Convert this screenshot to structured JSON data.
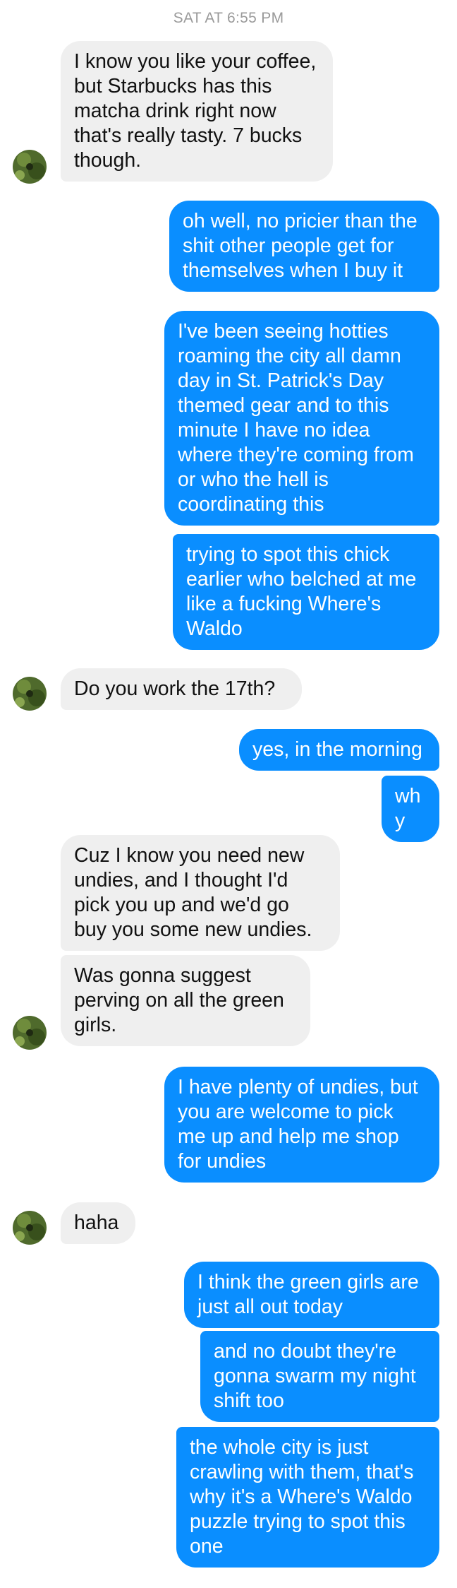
{
  "thread": {
    "timestamp": "SAT AT 6:55 PM",
    "messages": [
      {
        "from": "them",
        "text": "I know you like your coffee, but Starbucks has this matcha drink right now that's really tasty. 7 bucks though."
      },
      {
        "from": "me",
        "text": "oh well, no pricier than the shit other people get for themselves when I buy it"
      },
      {
        "from": "me",
        "text": "I've been seeing hotties roaming the city all damn day in St. Patrick's Day themed gear and to this minute I have no idea where they're coming from or who the hell is coordinating this"
      },
      {
        "from": "me",
        "text": "trying to spot this chick earlier who belched at me like a fucking Where's Waldo"
      },
      {
        "from": "them",
        "text": "Do you work the 17th?"
      },
      {
        "from": "me",
        "text": "yes, in the morning"
      },
      {
        "from": "me",
        "text": "why"
      },
      {
        "from": "them",
        "text": "Cuz I know you need new undies, and I thought I'd pick you up and we'd go buy you some new undies."
      },
      {
        "from": "them",
        "text": "Was gonna suggest perving on all the green girls."
      },
      {
        "from": "me",
        "text": "I have plenty of undies, but you are welcome to pick me up and help me shop for undies"
      },
      {
        "from": "them",
        "text": "haha"
      },
      {
        "from": "me",
        "text": "I think the green girls are just all out today"
      },
      {
        "from": "me",
        "text": "and no doubt they're gonna swarm my night shift too"
      },
      {
        "from": "me",
        "text": "the whole city is just crawling with them, that's why it's a Where's Waldo puzzle trying to spot this one"
      }
    ]
  },
  "colors": {
    "outgoing_bubble": "#0a8eff",
    "incoming_bubble": "#efefef",
    "timestamp_text": "#9a9a9a"
  },
  "icons": {
    "avatar": "contact-avatar-icon"
  }
}
